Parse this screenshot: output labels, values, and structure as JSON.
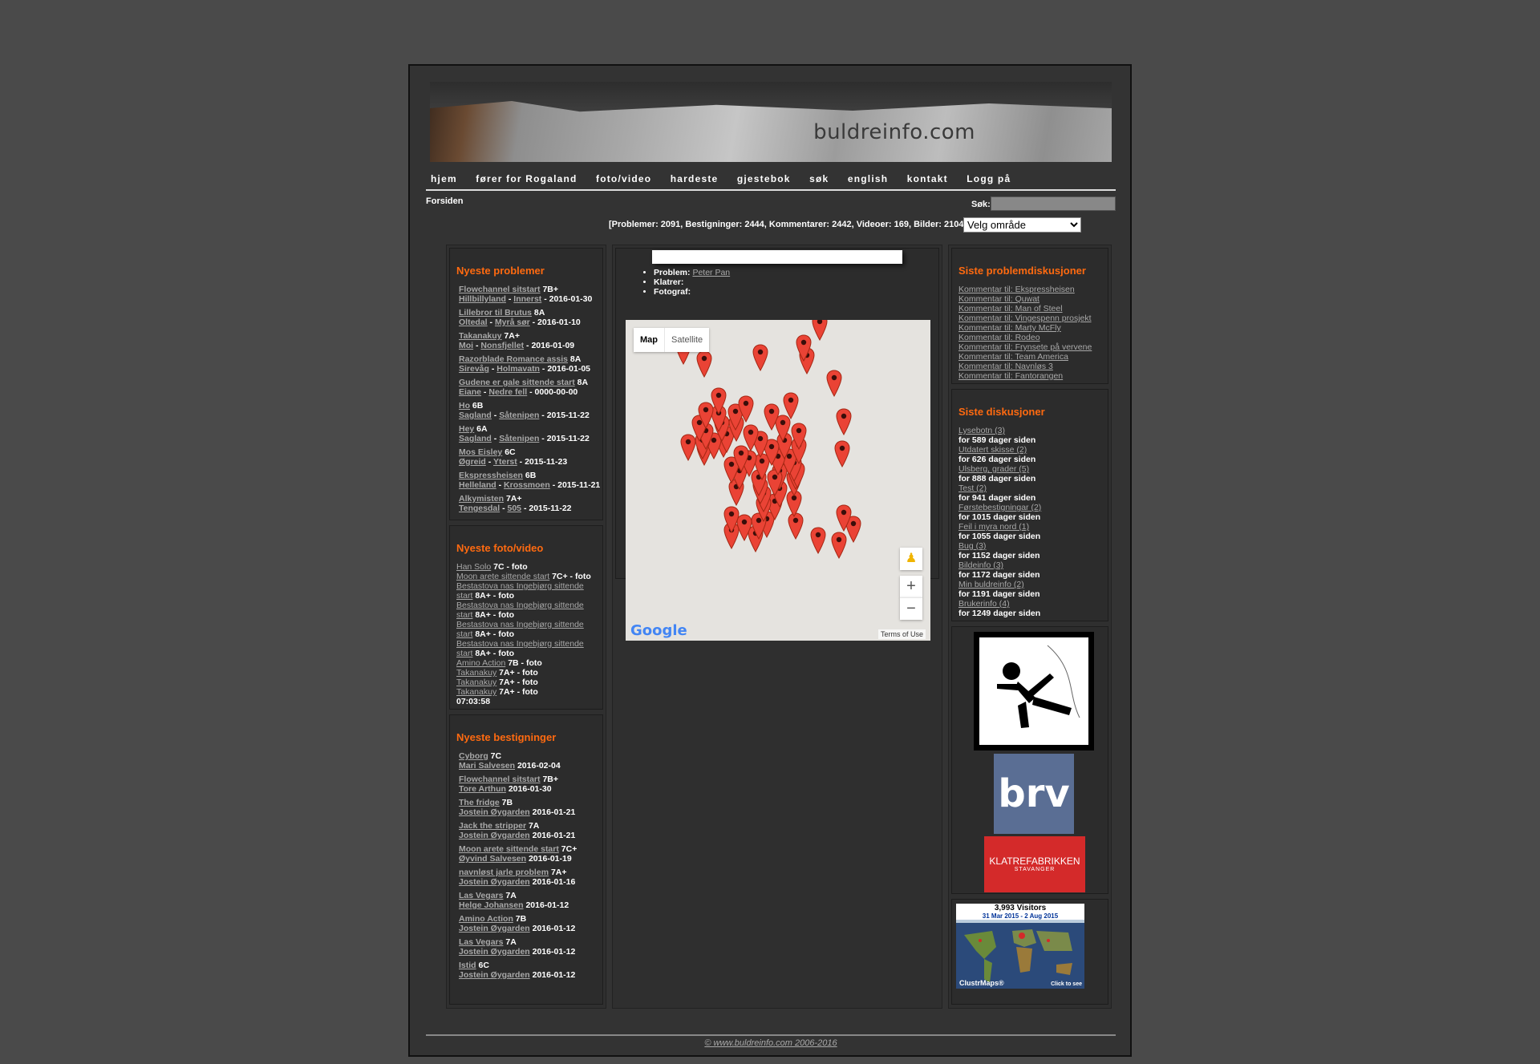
{
  "site": {
    "logo": "buldreinfo.com"
  },
  "nav": [
    "hjem",
    "fører for Rogaland",
    "foto/video",
    "hardeste",
    "gjestebok",
    "søk",
    "english",
    "kontakt",
    "Logg på"
  ],
  "breadcrumb": "Forsiden",
  "search": {
    "label": "Søk:",
    "value": ""
  },
  "stats": "[Problemer: 2091, Bestigninger: 2444, Kommentarer: 2442, Videoer: 169, Bilder: 2104]",
  "area_select": "Velg område",
  "newest_problems": {
    "title": "Nyeste problemer",
    "items": [
      {
        "name": "Flowchannel sitstart",
        "grade": "7B+",
        "area": "Hillbillyland",
        "sector": "Innerst",
        "date": "2016-01-30"
      },
      {
        "name": "Lillebror til Brutus",
        "grade": "8A",
        "area": "Oltedal",
        "sector": "Myrå sør",
        "date": "2016-01-10"
      },
      {
        "name": "Takanakuy",
        "grade": "7A+",
        "area": "Moi",
        "sector": "Nonsfjellet",
        "date": "2016-01-09"
      },
      {
        "name": "Razorblade Romance assis",
        "grade": "8A",
        "area": "Sirevåg",
        "sector": "Holmavatn",
        "date": "2016-01-05"
      },
      {
        "name": "Gudene er gale sittende start",
        "grade": "8A",
        "area": "Eiane",
        "sector": "Nedre fell",
        "date": "0000-00-00"
      },
      {
        "name": "Ho",
        "grade": "6B",
        "area": "Sagland",
        "sector": "Såtenipen",
        "date": "2015-11-22"
      },
      {
        "name": "Hey",
        "grade": "6A",
        "area": "Sagland",
        "sector": "Såtenipen",
        "date": "2015-11-22"
      },
      {
        "name": "Mos Eisley",
        "grade": "6C",
        "area": "Øgreid",
        "sector": "Yterst",
        "date": "2015-11-23"
      },
      {
        "name": "Ekspressheisen",
        "grade": "6B",
        "area": "Helleland",
        "sector": "Krossmoen",
        "date": "2015-11-21"
      },
      {
        "name": "Alkymisten",
        "grade": "7A+",
        "area": "Tengesdal",
        "sector": "505",
        "date": "2015-11-22"
      }
    ]
  },
  "newest_media": {
    "title": "Nyeste foto/video",
    "items": [
      {
        "name": "Han Solo",
        "suffix": "7C - foto"
      },
      {
        "name": "Moon arete sittende start",
        "suffix": "7C+ - foto"
      },
      {
        "name": "Bestastova nas Ingebjørg sittende",
        "name2": "start",
        "suffix": "8A+ - foto"
      },
      {
        "name": "Bestastova nas Ingebjørg sittende",
        "name2": "start",
        "suffix": "8A+ - foto"
      },
      {
        "name": "Bestastova nas Ingebjørg sittende",
        "name2": "start",
        "suffix": "8A+ - foto"
      },
      {
        "name": "Bestastova nas Ingebjørg sittende",
        "name2": "start",
        "suffix": "8A+ - foto"
      },
      {
        "name": "Amino Action",
        "suffix": "7B - foto"
      },
      {
        "name": "Takanakuy",
        "suffix": "7A+ - foto"
      },
      {
        "name": "Takanakuy",
        "suffix": "7A+ - foto"
      },
      {
        "name": "Takanakuy",
        "suffix": "7A+ - foto"
      }
    ],
    "time": "07:03:58"
  },
  "newest_ascents": {
    "title": "Nyeste bestigninger",
    "items": [
      {
        "name": "Cyborg",
        "grade": "7C",
        "user": "Mari Salvesen",
        "date": "2016-02-04"
      },
      {
        "name": "Flowchannel sitstart",
        "grade": "7B+",
        "user": "Tore Arthun",
        "date": "2016-01-30"
      },
      {
        "name": "The fridge",
        "grade": "7B",
        "user": "Jostein Øygarden",
        "date": "2016-01-21"
      },
      {
        "name": "Jack the stripper",
        "grade": "7A",
        "user": "Jostein Øygarden",
        "date": "2016-01-21"
      },
      {
        "name": "Moon arete sittende start",
        "grade": "7C+",
        "user": "Øyvind Salvesen",
        "date": "2016-01-19"
      },
      {
        "name": "navnløst jarle problem",
        "grade": "7A+",
        "user": "Jostein Øygarden",
        "date": "2016-01-16"
      },
      {
        "name": "Las Vegars",
        "grade": "7A",
        "user": "Helge Johansen",
        "date": "2016-01-12"
      },
      {
        "name": "Amino Action",
        "grade": "7B",
        "user": "Jostein Øygarden",
        "date": "2016-01-12"
      },
      {
        "name": "Las Vegars",
        "grade": "7A",
        "user": "Jostein Øygarden",
        "date": "2016-01-12"
      },
      {
        "name": "Istid",
        "grade": "6C",
        "user": "Jostein Øygarden",
        "date": "2016-01-12"
      }
    ]
  },
  "center": {
    "problem_label": "Problem:",
    "problem_value": "Peter Pan",
    "climber_label": "Klatrer:",
    "photographer_label": "Fotograf:",
    "map_type": [
      "Map",
      "Satellite"
    ],
    "zoom_in": "+",
    "zoom_out": "−",
    "google": "Google",
    "terms": "Terms of Use"
  },
  "problem_discussions": {
    "title": "Siste problemdiskusjoner",
    "items": [
      "Kommentar til: Ekspressheisen",
      "Kommentar til: Quwat",
      "Kommentar til: Man of Steel",
      "Kommentar til: Vingespenn prosjekt",
      "Kommentar til: Marty McFly",
      "Kommentar til: Rodeo",
      "Kommentar til: Frynsete på vervene",
      "Kommentar til: Team America",
      "Kommentar til: Navnløs 3",
      "Kommentar til: Fantorangen"
    ]
  },
  "discussions": {
    "title": "Siste diskusjoner",
    "items": [
      {
        "name": "Lysebotn (3)",
        "when": "for 589 dager siden"
      },
      {
        "name": "Utdatert skisse (2)",
        "when": "for 626 dager siden"
      },
      {
        "name": "Ulsberg, grader (5)",
        "when": "for 888 dager siden"
      },
      {
        "name": "Test (2)",
        "when": "for 941 dager siden"
      },
      {
        "name": "Førstebestigningar (2)",
        "when": "for 1015 dager siden"
      },
      {
        "name": "Feil i myra nord (1)",
        "when": "for 1055 dager siden"
      },
      {
        "name": "Bug (3)",
        "when": "for 1152 dager siden"
      },
      {
        "name": "Bildeinfo (3)",
        "when": "for 1172 dager siden"
      },
      {
        "name": "Min buldreinfo (2)",
        "when": "for 1191 dager siden"
      },
      {
        "name": "Brukerinfo (4)",
        "when": "for 1249 dager siden"
      }
    ]
  },
  "sponsors": {
    "brv": "brv",
    "klatrefabrikken": "KLATREFABRIKKEN",
    "klatre_sub": "STAVANGER"
  },
  "clustrmaps": {
    "visitors": "3,993 Visitors",
    "range": "31 Mar 2015 - 2 Aug 2015",
    "brand": "ClustrMaps®",
    "cta": "Click to see"
  },
  "footer": "© www.buldreinfo.com 2006-2016",
  "colors": {
    "accent": "#ff6a10",
    "bg": "#4a4a4a",
    "panel": "#333333",
    "link": "#a8a8a8",
    "pin": "#ea4335"
  }
}
